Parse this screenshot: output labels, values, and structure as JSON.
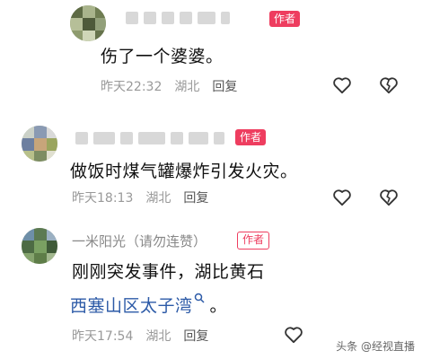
{
  "comments": [
    {
      "name": "",
      "badge": "作者",
      "text": "伤了一个婆婆。",
      "time": "昨天22:32",
      "location": "湖北",
      "reply": "回复"
    },
    {
      "name": "",
      "badge": "作者",
      "text": "做饭时煤气罐爆炸引发火灾。",
      "time": "昨天18:13",
      "location": "湖北",
      "reply": "回复"
    },
    {
      "name": "一米阳光（请勿连赞）",
      "badge": "作者",
      "text_line1": "刚刚突发事件，湖比黄石",
      "text_link": "西塞山区太子湾",
      "text_end": "。",
      "time": "昨天17:54",
      "location": "湖北",
      "reply": "回复"
    }
  ],
  "icons": {
    "like": "heart-outline-icon",
    "dislike": "broken-heart-icon",
    "search": "search-icon"
  },
  "colors": {
    "badge": "#ee3d5f",
    "link": "#2c5aa7",
    "meta": "#999999"
  },
  "watermark": "头条 @经视直播"
}
